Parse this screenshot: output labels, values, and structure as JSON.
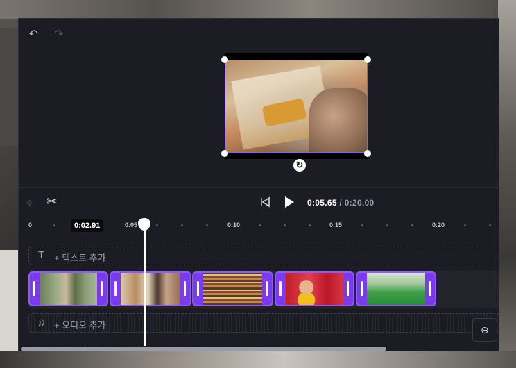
{
  "toolbar": {
    "current_time": "0:05.65",
    "total_time": "/ 0:20.00"
  },
  "ruler": {
    "hover_time": "0:02.91",
    "labels": [
      "0",
      "0:05",
      "0:10",
      "0:15",
      "0:20"
    ]
  },
  "tracks": {
    "text_label": "+ 텍스트 추가",
    "audio_label": "+ 오디오 추가",
    "clips": [
      "clip-1",
      "clip-2",
      "clip-3",
      "clip-4",
      "clip-5"
    ]
  },
  "colors": {
    "accent": "#8b5cf6",
    "panel": "#1c1c24"
  },
  "icons": [
    "undo-icon",
    "redo-icon",
    "rotate-icon",
    "sparkle-icon",
    "scissors-icon",
    "skip-back-icon",
    "play-icon",
    "text-icon",
    "music-icon",
    "zoom-out-icon"
  ]
}
